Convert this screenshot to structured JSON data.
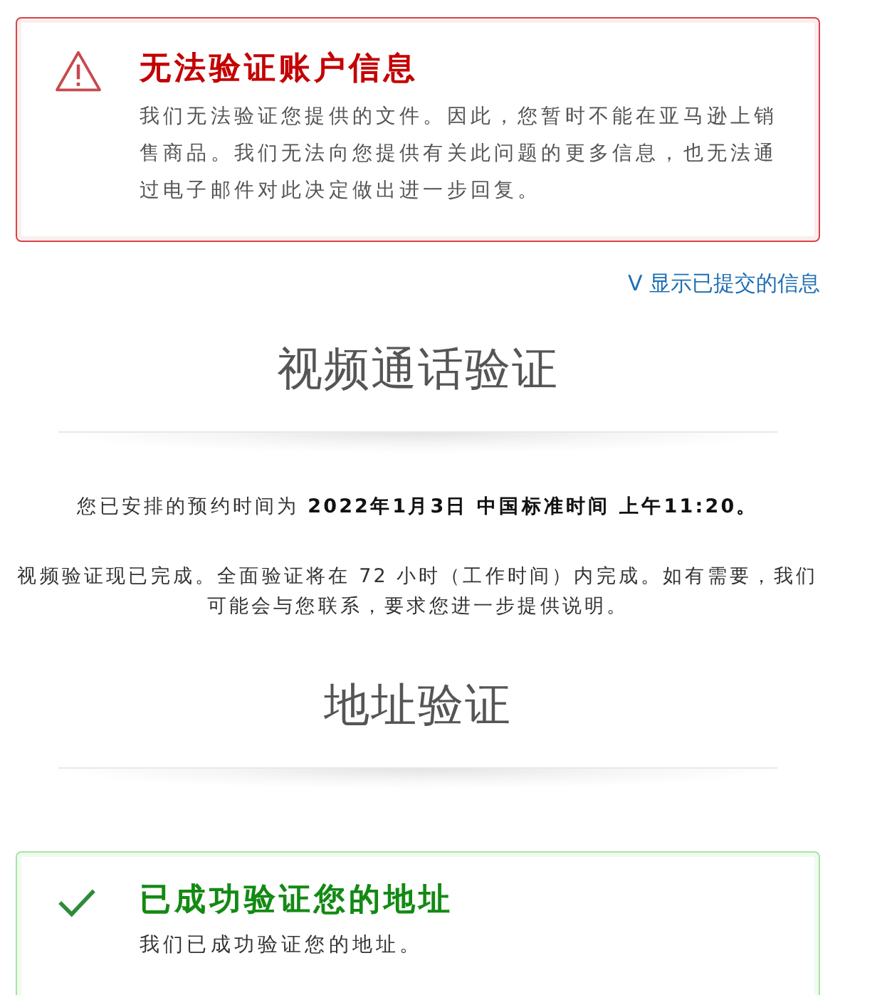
{
  "error_alert": {
    "kind": "error",
    "title": "无法验证账户信息",
    "message": "我们无法验证您提供的文件。因此，您暂时不能在亚马逊上销售商品。我们无法向您提供有关此问题的更多信息，也无法通过电子邮件对此决定做出进一步回复。"
  },
  "toggle_link": {
    "icon": "V",
    "label": "显示已提交的信息",
    "expanded": false
  },
  "sections": [
    {
      "heading": "视频通话验证",
      "paragraphs": [
        "您已安排的预约时间为 **2022年1月3日 中国标准时间 上午11:20。**",
        "视频验证现已完成。全面验证将在 72 小时（工作时间）内完成。如有需要，我们可能会与您联系，要求您进一步提供说明。"
      ]
    },
    {
      "heading": "地址验证",
      "alert": {
        "kind": "success",
        "title": "已成功验证您的地址",
        "message": "我们已成功验证您的地址。"
      }
    }
  ]
}
